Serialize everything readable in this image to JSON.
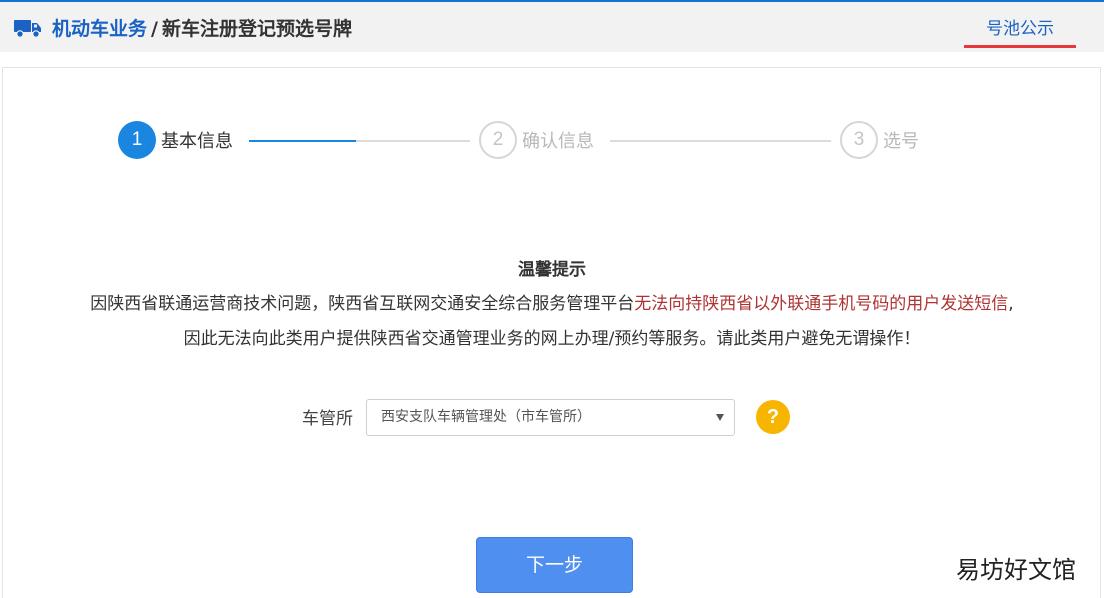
{
  "header": {
    "title_main": "机动车业务",
    "separator": "/",
    "title_sub": "新车注册登记预选号牌",
    "pool_link": "号池公示",
    "accent_color": "#1a62c4",
    "underline_color": "#e5373c",
    "icon": "truck-icon"
  },
  "steps": {
    "items": [
      {
        "number": "1",
        "label": "基本信息",
        "state": "active"
      },
      {
        "number": "2",
        "label": "确认信息",
        "state": "inactive"
      },
      {
        "number": "3",
        "label": "选号",
        "state": "inactive"
      }
    ],
    "progress": 1,
    "active_color": "#1a86e0"
  },
  "notice": {
    "title": "温馨提示",
    "line1_before": "因陕西省联通运营商技术问题，陕西省互联网交通安全综合服务管理平台",
    "line1_highlight": "无法向持陕西省以外联通手机号码的用户发送短信",
    "line1_after": ",",
    "line2": "因此无法向此类用户提供陕西省交通管理业务的网上办理/预约等服务。请此类用户避免无谓操作！",
    "highlight_color": "#b03333"
  },
  "form": {
    "office_label": "车管所",
    "office_value": "西安支队车辆管理处（市车管所）",
    "help_icon": "?",
    "help_color": "#f7b500"
  },
  "actions": {
    "next_label": "下一步",
    "button_color": "#4f8ff0"
  },
  "watermark": "易坊好文馆"
}
